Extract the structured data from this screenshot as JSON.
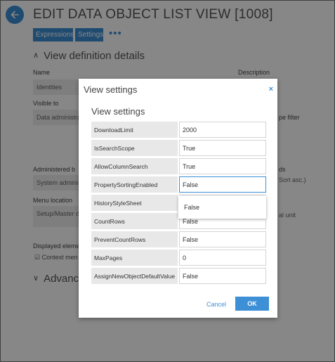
{
  "page": {
    "title": "EDIT DATA OBJECT LIST VIEW [1008]",
    "tabs": [
      {
        "label": "Expressions"
      },
      {
        "label": "Settings"
      }
    ],
    "more_label": "•••",
    "section_view_definition": "View definition details",
    "section_advanced": "Advanc",
    "name_label": "Name",
    "name_value": "Identities",
    "description_label": "Description",
    "visible_to_label": "Visible to",
    "visible_to_value": "Data administrat",
    "scope_filter_label": "pe filter",
    "administered_by_label": "Administered b",
    "administered_by_value": "System adminis",
    "fields_label": "ds",
    "fields_value": "Sort asc.)",
    "menu_location_label": "Menu location",
    "menu_location_value": "Setup/Master d",
    "unit_value": "al unit",
    "displayed_elements_label": "Displayed eleme",
    "context_menu_label": "Context men"
  },
  "dialog": {
    "title": "View settings",
    "close_label": "×",
    "subtitle": "View settings",
    "settings": [
      {
        "label": "DownloadLimit",
        "value": "2000"
      },
      {
        "label": "IsSearchScope",
        "value": "True"
      },
      {
        "label": "AllowColumnSearch",
        "value": "True"
      },
      {
        "label": "PropertySortingEnabled",
        "value": "False"
      },
      {
        "label": "HistoryStyleSheet",
        "value": ""
      },
      {
        "label": "CountRows",
        "value": "False"
      },
      {
        "label": "PreventCountRows",
        "value": "False"
      },
      {
        "label": "MaxPages",
        "value": "0"
      },
      {
        "label": "AssignNewObjectDefaultValue",
        "value": "False"
      }
    ],
    "dropdown_option": "False",
    "cancel_label": "Cancel",
    "ok_label": "OK"
  },
  "colors": {
    "accent": "#3d8fd6",
    "overlay": "rgba(0,0,0,0.47)"
  },
  "icons": {
    "back": "arrow-left-icon",
    "collapse": "chevron-up-icon",
    "expand": "chevron-down-icon",
    "close": "close-icon",
    "checkbox": "checkbox-checked-icon"
  }
}
